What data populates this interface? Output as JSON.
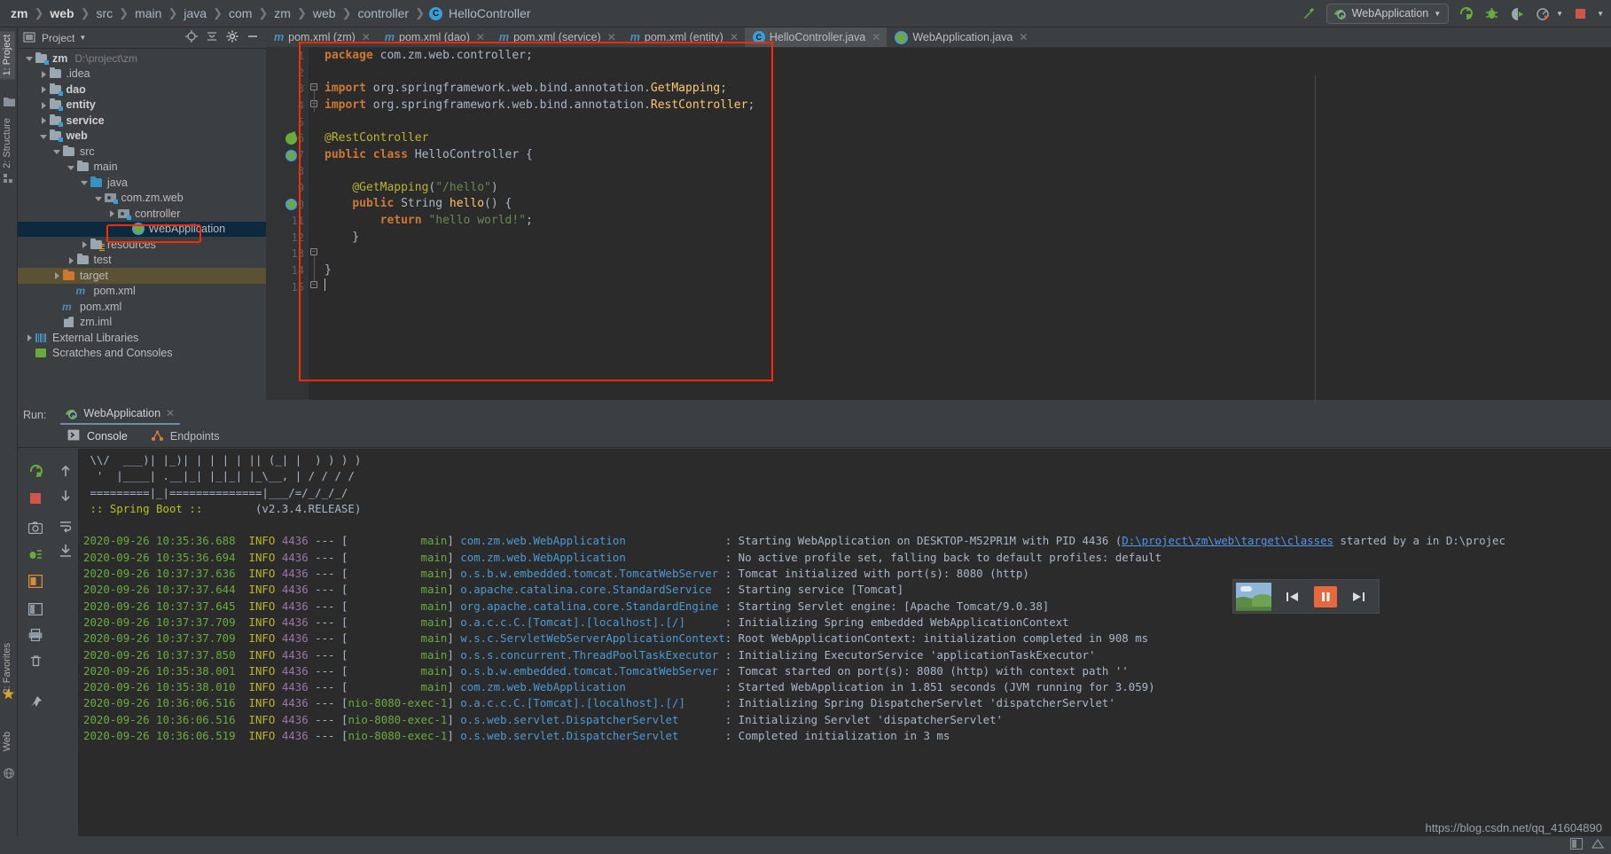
{
  "window": {
    "breadcrumb": [
      "zm",
      "web",
      "src",
      "main",
      "java",
      "com",
      "zm",
      "web",
      "controller"
    ],
    "breadcrumb_class": "HelloController",
    "breadcrumb_class_icon": "class-icon"
  },
  "toolbar": {
    "build_icon": "build-hammer-icon",
    "run_config_name": "WebApplication",
    "run_config_icon": "spring-boot-icon",
    "dropdown_icon": "chevron-down-icon",
    "run_icon": "run-icon",
    "debug_icon": "debug-bug-icon",
    "run_coverage_icon": "run-with-coverage-icon",
    "profile_icon": "profiler-icon",
    "profile_dropdown_icon": "chevron-down-icon",
    "stop_icon": "stop-icon"
  },
  "left_tool_strip": {
    "tabs": [
      {
        "label": "1: Project",
        "active": true,
        "name": "tool-tab-project"
      },
      {
        "label": "2: Structure",
        "active": false,
        "name": "tool-tab-structure"
      },
      {
        "label": "2: Favorites",
        "active": false,
        "name": "tool-tab-favorites"
      },
      {
        "label": "Web",
        "active": false,
        "name": "tool-tab-web"
      }
    ]
  },
  "project_panel": {
    "title": "Project",
    "caret_icon": "chevron-down-icon",
    "actions": [
      "locate-icon",
      "collapse-all-icon",
      "settings-gear-icon",
      "hide-icon"
    ],
    "tree": [
      {
        "label": "zm",
        "path": "D:\\project\\zm",
        "indent": 0,
        "arrow": "down",
        "icon": "module-folder",
        "bold": true
      },
      {
        "label": ".idea",
        "path": "",
        "indent": 1,
        "arrow": "right",
        "icon": "folder",
        "bold": false
      },
      {
        "label": "dao",
        "path": "",
        "indent": 1,
        "arrow": "right",
        "icon": "module-folder",
        "bold": true
      },
      {
        "label": "entity",
        "path": "",
        "indent": 1,
        "arrow": "right",
        "icon": "module-folder",
        "bold": true
      },
      {
        "label": "service",
        "path": "",
        "indent": 1,
        "arrow": "right",
        "icon": "module-folder",
        "bold": true
      },
      {
        "label": "web",
        "path": "",
        "indent": 1,
        "arrow": "down",
        "icon": "module-folder",
        "bold": true
      },
      {
        "label": "src",
        "path": "",
        "indent": 2,
        "arrow": "down",
        "icon": "folder",
        "bold": false
      },
      {
        "label": "main",
        "path": "",
        "indent": 3,
        "arrow": "down",
        "icon": "folder",
        "bold": false
      },
      {
        "label": "java",
        "path": "",
        "indent": 4,
        "arrow": "down",
        "icon": "source-folder",
        "bold": false
      },
      {
        "label": "com.zm.web",
        "path": "",
        "indent": 5,
        "arrow": "down",
        "icon": "package",
        "bold": false
      },
      {
        "label": "controller",
        "path": "",
        "indent": 6,
        "arrow": "right",
        "icon": "package",
        "bold": false,
        "highlight_box": true
      },
      {
        "label": "WebApplication",
        "path": "",
        "indent": 7,
        "arrow": "none",
        "icon": "spring-class",
        "bold": false,
        "selected": true
      },
      {
        "label": "resources",
        "path": "",
        "indent": 4,
        "arrow": "right",
        "icon": "resources-folder",
        "bold": false
      },
      {
        "label": "test",
        "path": "",
        "indent": 3,
        "arrow": "right",
        "icon": "folder",
        "bold": false
      },
      {
        "label": "target",
        "path": "",
        "indent": 2,
        "arrow": "right",
        "icon": "excluded-folder",
        "bold": false,
        "row_highlight": true
      },
      {
        "label": "pom.xml",
        "path": "",
        "indent": 3,
        "arrow": "none",
        "icon": "maven",
        "bold": false
      },
      {
        "label": "pom.xml",
        "path": "",
        "indent": 2,
        "arrow": "none",
        "icon": "maven",
        "bold": false
      },
      {
        "label": "zm.iml",
        "path": "",
        "indent": 2,
        "arrow": "none",
        "icon": "iml",
        "bold": false
      },
      {
        "label": "External Libraries",
        "path": "",
        "indent": 0,
        "arrow": "right",
        "icon": "library",
        "bold": false
      },
      {
        "label": "Scratches and Consoles",
        "path": "",
        "indent": 0,
        "arrow": "none",
        "icon": "scratch",
        "bold": false
      }
    ]
  },
  "editor": {
    "tabs": [
      {
        "label": "pom.xml (zm)",
        "icon": "maven-icon",
        "active": false,
        "closable": true
      },
      {
        "label": "pom.xml (dao)",
        "icon": "maven-icon",
        "active": false,
        "closable": true
      },
      {
        "label": "pom.xml (service)",
        "icon": "maven-icon",
        "active": false,
        "closable": true
      },
      {
        "label": "pom.xml (entity)",
        "icon": "maven-icon",
        "active": false,
        "closable": true
      },
      {
        "label": "HelloController.java",
        "icon": "class-icon",
        "active": true,
        "closable": true
      },
      {
        "label": "WebApplication.java",
        "icon": "spring-icon",
        "active": false,
        "closable": true
      }
    ],
    "line_numbers": [
      "1",
      "2",
      "3",
      "4",
      "5",
      "6",
      "7",
      "8",
      "9",
      "10",
      "11",
      "12",
      "13",
      "14",
      "15"
    ],
    "code_lines": [
      "package com.zm.web.controller;",
      "",
      "import org.springframework.web.bind.annotation.GetMapping;",
      "import org.springframework.web.bind.annotation.RestController;",
      "",
      "@RestController",
      "public class HelloController {",
      "",
      "    @GetMapping(\"/hello\")",
      "    public String hello() {",
      "        return \"hello world!\";",
      "    }",
      "",
      "}",
      ""
    ]
  },
  "run_panel": {
    "run_label": "Run:",
    "tab_label": "WebApplication",
    "tab_icon": "spring-boot-icon",
    "tab_close_icon": "close-icon",
    "subtabs": [
      {
        "label": "Console",
        "icon": "console-icon",
        "active": true
      },
      {
        "label": "Endpoints",
        "icon": "endpoints-icon",
        "active": false
      }
    ],
    "side_buttons": [
      "rerun-icon",
      "stop-icon",
      "camera-icon",
      "thread-dump-icon",
      "restore-layout-icon",
      "print-icon",
      "trash-icon",
      "pin-icon",
      "scroll-up-icon",
      "scroll-down-icon",
      "soft-wrap-icon",
      "scroll-to-end-icon"
    ],
    "banner": [
      " \\\\/  ___)| |_)| | | | | || (_| |  ) ) ) )",
      "  '  |____| .__|_| |_|_| |_\\__, | / / / /",
      " =========|_|==============|___/=/_/_/_/",
      " :: Spring Boot ::        (v2.3.4.RELEASE)"
    ],
    "spring_boot_version": "(v2.3.4.RELEASE)",
    "spring_boot_label": ":: Spring Boot ::",
    "log_lines": [
      {
        "time": "2020-09-26 10:35:36.688",
        "level": "INFO",
        "pid": "4436",
        "thread": "main",
        "logger": "com.zm.web.WebApplication",
        "message": ": Starting WebApplication on DESKTOP-M52PR1M with PID 4436 (",
        "link": "D:\\project\\zm\\web\\target\\classes",
        "message2": " started by a in D:\\projec"
      },
      {
        "time": "2020-09-26 10:35:36.694",
        "level": "INFO",
        "pid": "4436",
        "thread": "main",
        "logger": "com.zm.web.WebApplication",
        "message": ": No active profile set, falling back to default profiles: default",
        "link": "",
        "message2": ""
      },
      {
        "time": "2020-09-26 10:37:37.636",
        "level": "INFO",
        "pid": "4436",
        "thread": "main",
        "logger": "o.s.b.w.embedded.tomcat.TomcatWebServer",
        "message": ": Tomcat initialized with port(s): 8080 (http)",
        "link": "",
        "message2": ""
      },
      {
        "time": "2020-09-26 10:37:37.644",
        "level": "INFO",
        "pid": "4436",
        "thread": "main",
        "logger": "o.apache.catalina.core.StandardService",
        "message": ": Starting service [Tomcat]",
        "link": "",
        "message2": ""
      },
      {
        "time": "2020-09-26 10:37:37.645",
        "level": "INFO",
        "pid": "4436",
        "thread": "main",
        "logger": "org.apache.catalina.core.StandardEngine",
        "message": ": Starting Servlet engine: [Apache Tomcat/9.0.38]",
        "link": "",
        "message2": ""
      },
      {
        "time": "2020-09-26 10:37:37.709",
        "level": "INFO",
        "pid": "4436",
        "thread": "main",
        "logger": "o.a.c.c.C.[Tomcat].[localhost].[/]",
        "message": ": Initializing Spring embedded WebApplicationContext",
        "link": "",
        "message2": ""
      },
      {
        "time": "2020-09-26 10:37:37.709",
        "level": "INFO",
        "pid": "4436",
        "thread": "main",
        "logger": "w.s.c.ServletWebServerApplicationContext",
        "message": ": Root WebApplicationContext: initialization completed in 908 ms",
        "link": "",
        "message2": ""
      },
      {
        "time": "2020-09-26 10:37:37.850",
        "level": "INFO",
        "pid": "4436",
        "thread": "main",
        "logger": "o.s.s.concurrent.ThreadPoolTaskExecutor",
        "message": ": Initializing ExecutorService 'applicationTaskExecutor'",
        "link": "",
        "message2": ""
      },
      {
        "time": "2020-09-26 10:35:38.001",
        "level": "INFO",
        "pid": "4436",
        "thread": "main",
        "logger": "o.s.b.w.embedded.tomcat.TomcatWebServer",
        "message": ": Tomcat started on port(s): 8080 (http) with context path ''",
        "link": "",
        "message2": ""
      },
      {
        "time": "2020-09-26 10:35:38.010",
        "level": "INFO",
        "pid": "4436",
        "thread": "main",
        "logger": "com.zm.web.WebApplication",
        "message": ": Started WebApplication in 1.851 seconds (JVM running for 3.059)",
        "link": "",
        "message2": ""
      },
      {
        "time": "2020-09-26 10:36:06.516",
        "level": "INFO",
        "pid": "4436",
        "thread": "nio-8080-exec-1",
        "logger": "o.a.c.c.C.[Tomcat].[localhost].[/]",
        "message": ": Initializing Spring DispatcherServlet 'dispatcherServlet'",
        "link": "",
        "message2": ""
      },
      {
        "time": "2020-09-26 10:36:06.516",
        "level": "INFO",
        "pid": "4436",
        "thread": "nio-8080-exec-1",
        "logger": "o.s.web.servlet.DispatcherServlet",
        "message": ": Initializing Servlet 'dispatcherServlet'",
        "link": "",
        "message2": ""
      },
      {
        "time": "2020-09-26 10:36:06.519",
        "level": "INFO",
        "pid": "4436",
        "thread": "nio-8080-exec-1",
        "logger": "o.s.web.servlet.DispatcherServlet",
        "message": ": Completed initialization in 3 ms",
        "link": "",
        "message2": ""
      }
    ]
  },
  "video_widget": {
    "prev_icon": "previous-track-icon",
    "pause_icon": "pause-icon",
    "next_icon": "next-track-icon",
    "thumbnail": "video-thumbnail"
  },
  "watermark": "https://blog.csdn.net/qq_41604890",
  "colors": {
    "accent_blue": "#3592c4",
    "highlight_red": "#ff2a00",
    "selection_blue": "#0d293e",
    "keyword_orange": "#cc7832",
    "string_green": "#6a8759",
    "annotation_yellow": "#bbb529",
    "editor_bg": "#2b2b2b",
    "panel_bg": "#3c3f41"
  }
}
